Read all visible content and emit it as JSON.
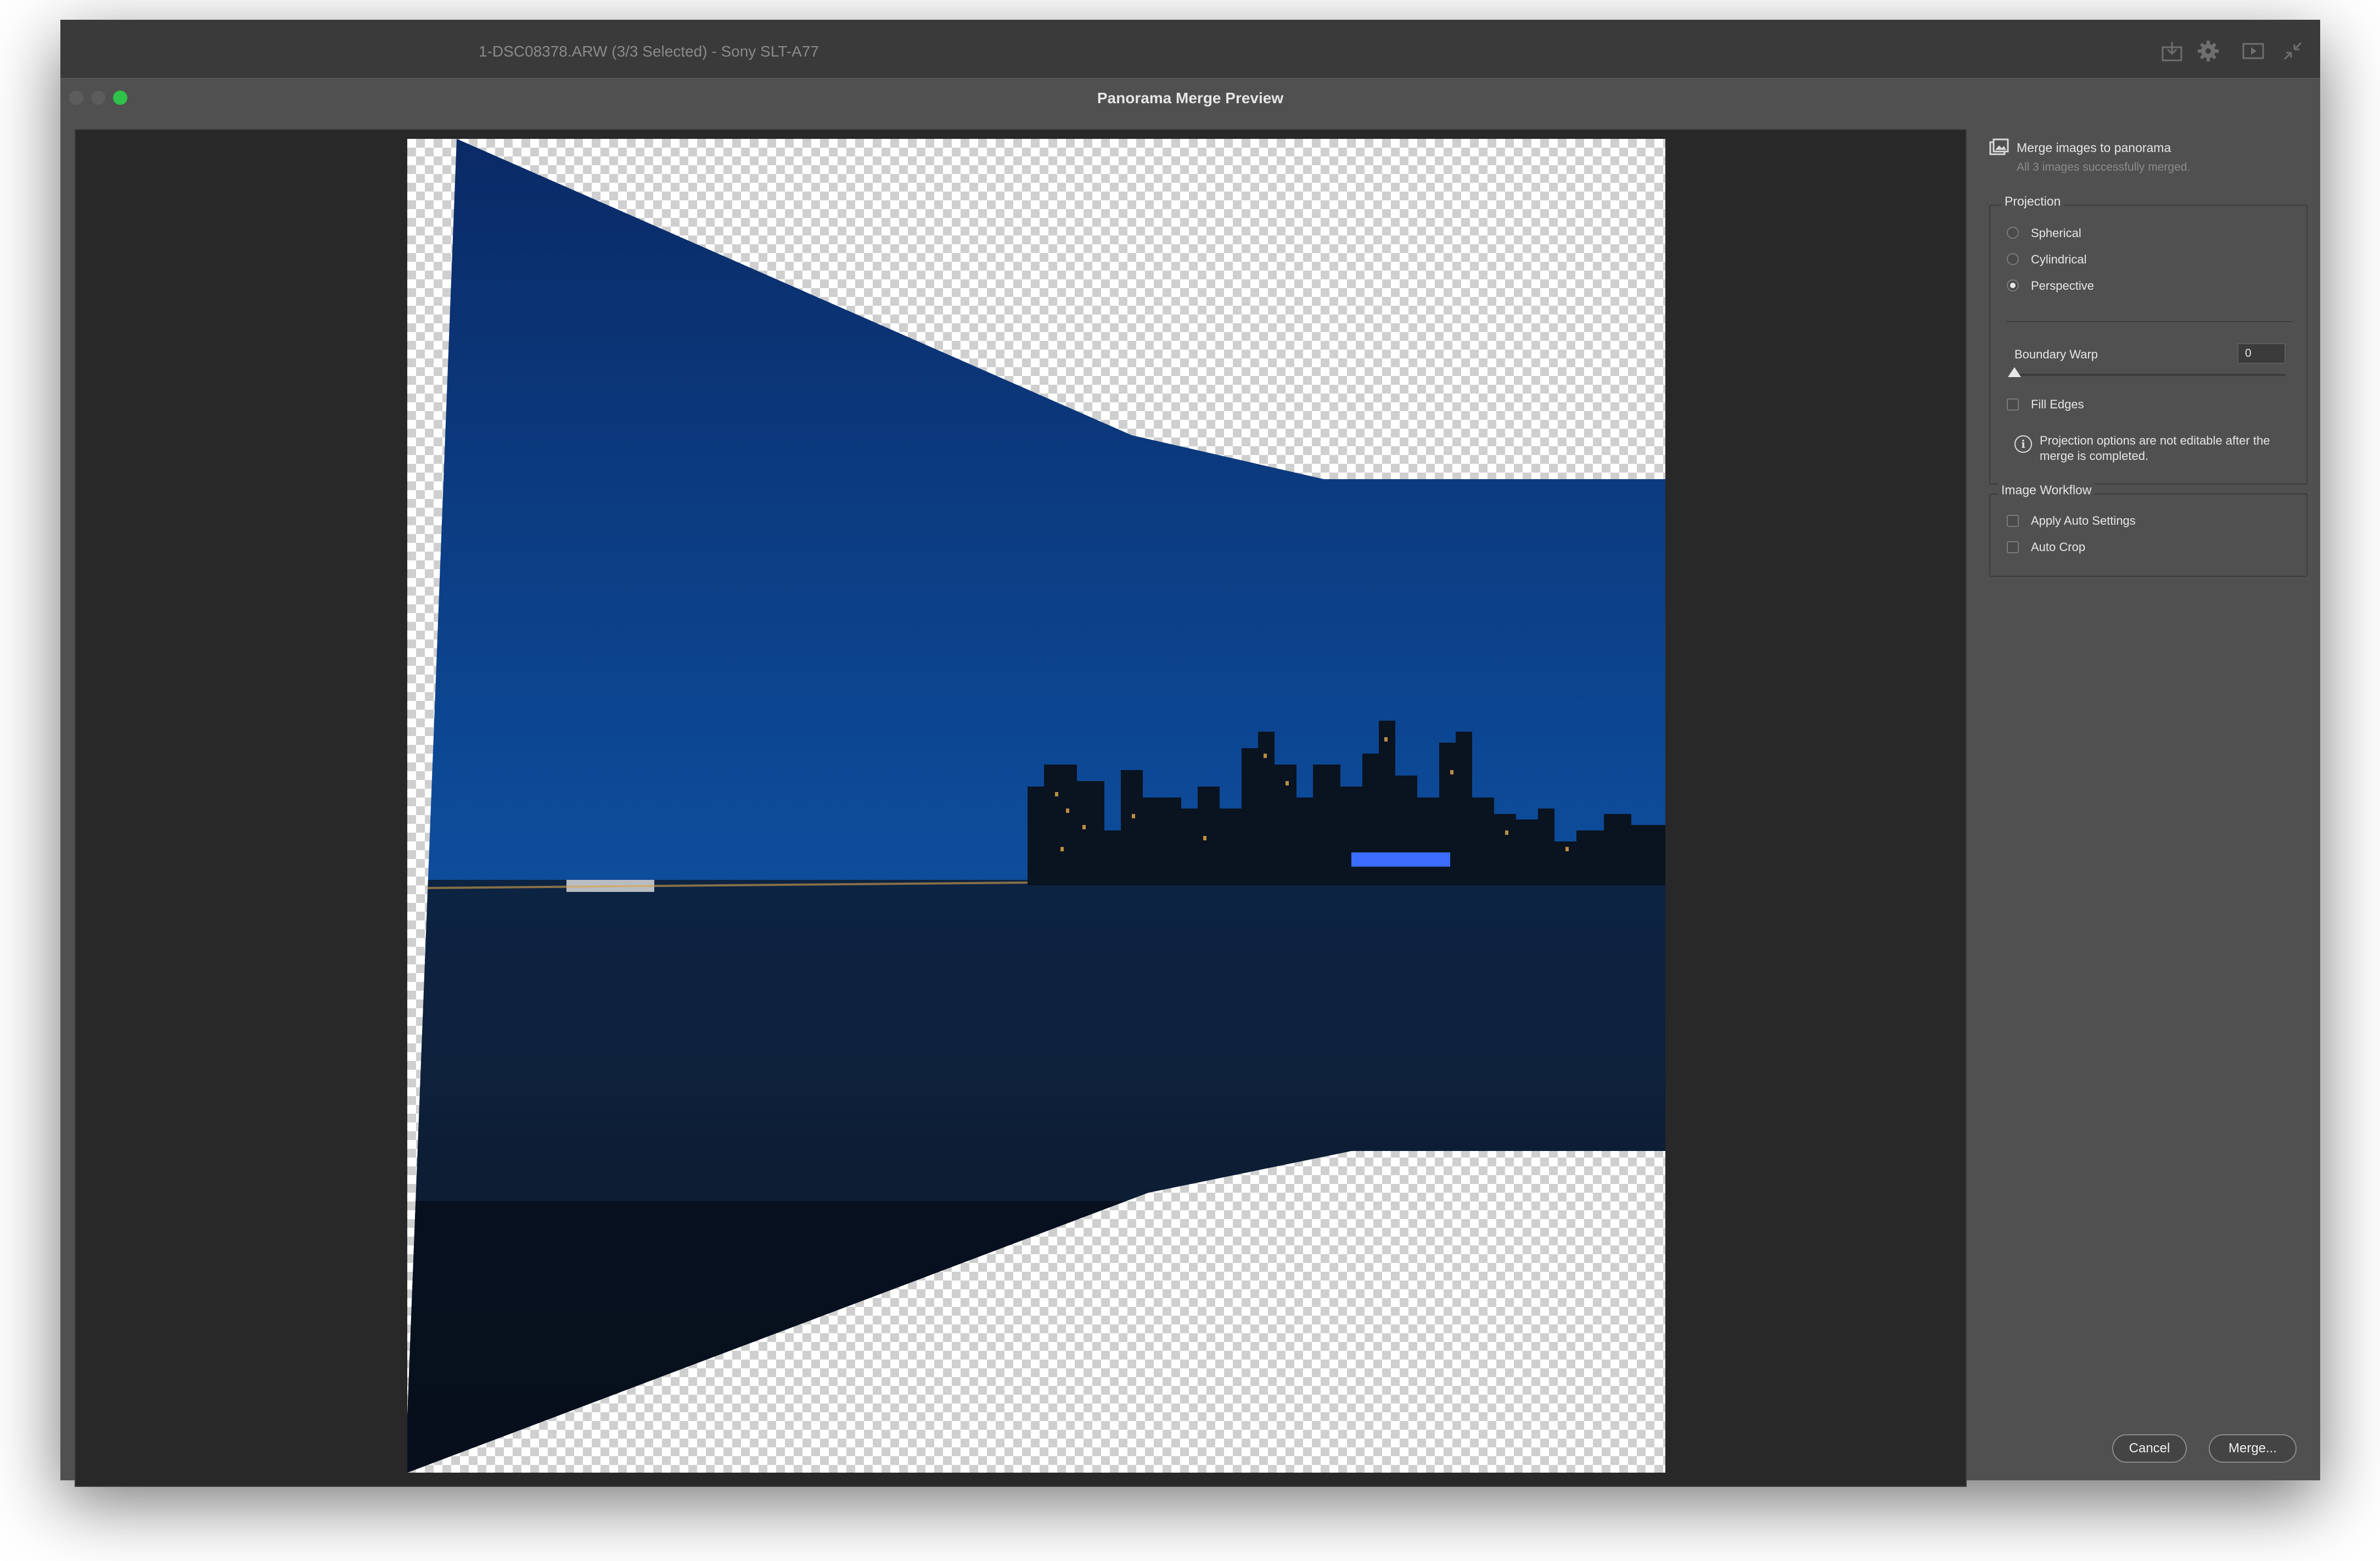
{
  "app": {
    "context_text": "1-DSC08378.ARW (3/3 Selected)  -  Sony SLT-A77",
    "header_icons": [
      "export-icon",
      "gear-icon",
      "slideshow-icon",
      "collapse-icon"
    ]
  },
  "dialog": {
    "title": "Panorama Merge Preview",
    "window_controls": {
      "close": "#5c5c5c",
      "minimize": "#5c5c5c",
      "zoom": "#2fc24b"
    }
  },
  "panel": {
    "header_title": "Merge images to panorama",
    "header_subtitle": "All 3 images successfully merged.",
    "projection": {
      "title": "Projection",
      "options": [
        {
          "label": "Spherical",
          "selected": false
        },
        {
          "label": "Cylindrical",
          "selected": false
        },
        {
          "label": "Perspective",
          "selected": true
        }
      ],
      "boundary_warp_label": "Boundary Warp",
      "boundary_warp_value": "0",
      "boundary_warp_level": 0,
      "fill_edges_label": "Fill Edges",
      "fill_edges_checked": false,
      "info_text": "Projection options are not editable after the merge is completed."
    },
    "workflow": {
      "title": "Image Workflow",
      "options": [
        {
          "label": "Apply Auto Settings",
          "checked": false
        },
        {
          "label": "Auto Crop",
          "checked": false
        }
      ]
    }
  },
  "buttons": {
    "cancel": "Cancel",
    "merge": "Merge..."
  },
  "colors": {
    "sky_top": "#0a2a66",
    "sky_mid": "#0d4d9c",
    "horizon": "#1e3a66",
    "water": "#0c1c33",
    "accent_green": "#2fc24b"
  }
}
